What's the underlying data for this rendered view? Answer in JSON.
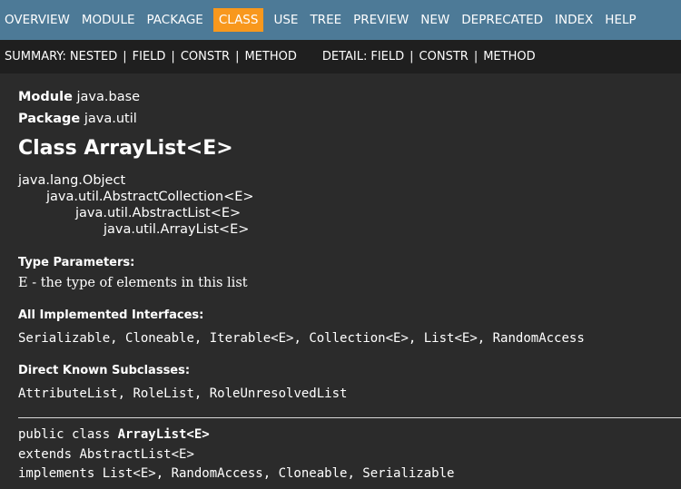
{
  "topnav": {
    "items": [
      {
        "label": "OVERVIEW"
      },
      {
        "label": "MODULE"
      },
      {
        "label": "PACKAGE"
      },
      {
        "label": "CLASS",
        "active": true
      },
      {
        "label": "USE"
      },
      {
        "label": "TREE"
      },
      {
        "label": "PREVIEW"
      },
      {
        "label": "NEW"
      },
      {
        "label": "DEPRECATED"
      },
      {
        "label": "INDEX"
      },
      {
        "label": "HELP"
      }
    ],
    "active_color": "#f8981d",
    "bar_color": "#4d7a97"
  },
  "subnav": {
    "summary_label": "SUMMARY:",
    "summary_links": [
      "NESTED",
      "FIELD",
      "CONSTR",
      "METHOD"
    ],
    "detail_label": "DETAIL:",
    "detail_links": [
      "FIELD",
      "CONSTR",
      "METHOD"
    ],
    "separator": "|"
  },
  "header": {
    "module_label": "Module",
    "module_value": "java.base",
    "package_label": "Package",
    "package_value": "java.util",
    "title": "Class ArrayList<E>"
  },
  "hierarchy": [
    "java.lang.Object",
    "java.util.AbstractCollection<E>",
    "java.util.AbstractList<E>",
    "java.util.ArrayList<E>"
  ],
  "type_parameters": {
    "title": "Type Parameters:",
    "text": "E - the type of elements in this list"
  },
  "interfaces": {
    "title": "All Implemented Interfaces:",
    "items": [
      "Serializable",
      "Cloneable",
      "Iterable<E>",
      "Collection<E>",
      "List<E>",
      "RandomAccess"
    ]
  },
  "subclasses": {
    "title": "Direct Known Subclasses:",
    "items": [
      "AttributeList",
      "RoleList",
      "RoleUnresolvedList"
    ]
  },
  "signature": {
    "line1_kw": "public class ",
    "line1_name": "ArrayList<E>",
    "line2_kw": "extends ",
    "line2_rest": "AbstractList<E>",
    "line3_kw": "implements ",
    "line3_rest": "List<E>, RandomAccess, Cloneable, Serializable"
  }
}
